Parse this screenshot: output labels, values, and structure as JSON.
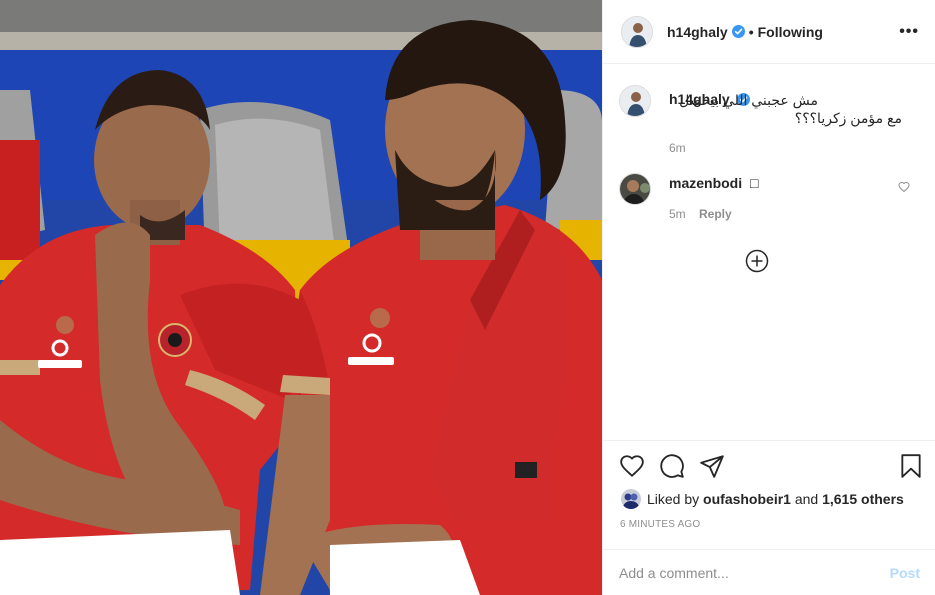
{
  "post": {
    "author": "h14ghaly",
    "follow_state": "Following",
    "separator": "•",
    "more_icon": "more-icon",
    "more_label": "•••"
  },
  "caption": {
    "username": "h14ghaly",
    "text": "مش عجبني اللي بيحصل مع مؤمن زكريا؟؟؟",
    "time": "6m"
  },
  "comments": [
    {
      "username": "mazenbodi",
      "text": "□",
      "time": "5m",
      "reply_label": "Reply"
    }
  ],
  "actions": {
    "like_icon": "heart-icon",
    "comment_icon": "comment-icon",
    "share_icon": "share-icon",
    "save_icon": "bookmark-icon",
    "liked_by_prefix": "Liked by",
    "liked_by_user": "oufashobeir1",
    "liked_by_and": "and",
    "liked_by_others": "1,615 others",
    "timestamp": "6 MINUTES AGO"
  },
  "add_comment": {
    "placeholder": "Add a comment...",
    "post_label": "Post"
  },
  "colors": {
    "verified_blue": "#3897f0",
    "post_button_disabled": "#b3dbff",
    "jersey_red": "#d42a2a"
  }
}
